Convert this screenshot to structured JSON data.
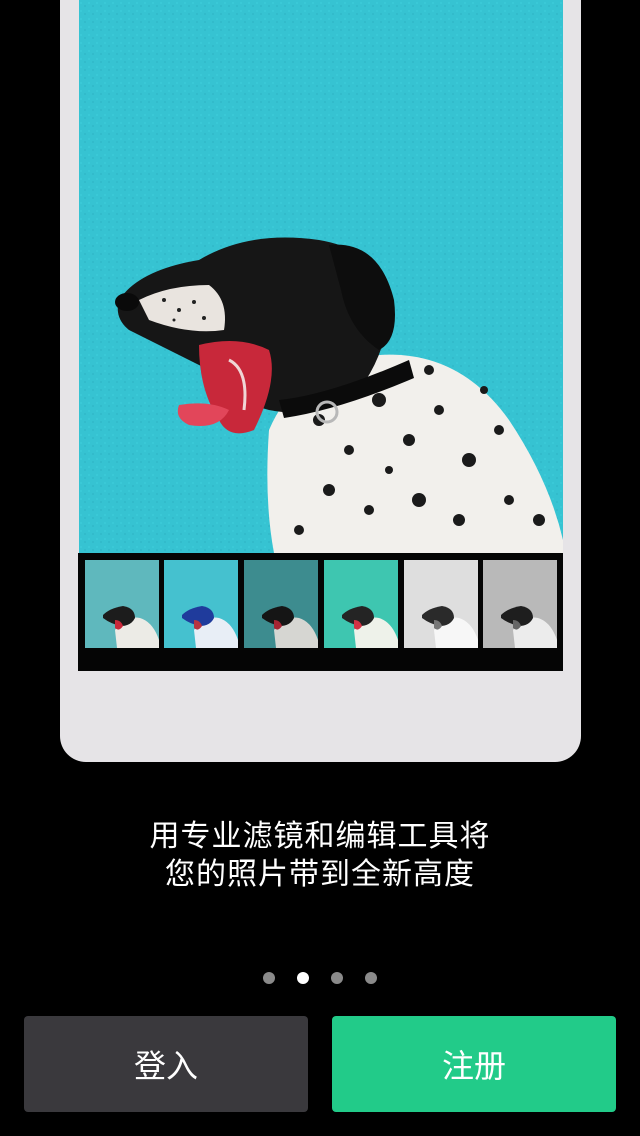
{
  "caption": {
    "line1": "用专业滤镜和编辑工具将",
    "line2": "您的照片带到全新高度"
  },
  "pager": {
    "total": 4,
    "active_index": 1
  },
  "buttons": {
    "login_label": "登入",
    "register_label": "注册"
  },
  "filters": [
    {
      "name": "filter-1",
      "bg": "#5fb8bd",
      "tint": "none"
    },
    {
      "name": "filter-2",
      "bg": "#45c1cf",
      "tint": "blue"
    },
    {
      "name": "filter-3",
      "bg": "#3d8c8f",
      "tint": "dark"
    },
    {
      "name": "filter-4",
      "bg": "#3ec6b0",
      "tint": "mint"
    },
    {
      "name": "filter-5",
      "bg": "#dedede",
      "tint": "mono-light"
    },
    {
      "name": "filter-6",
      "bg": "#b9b9b9",
      "tint": "mono"
    }
  ],
  "colors": {
    "accent": "#22cb89",
    "secondary_button": "#3a393d",
    "photo_wall": "#36c3d2"
  }
}
